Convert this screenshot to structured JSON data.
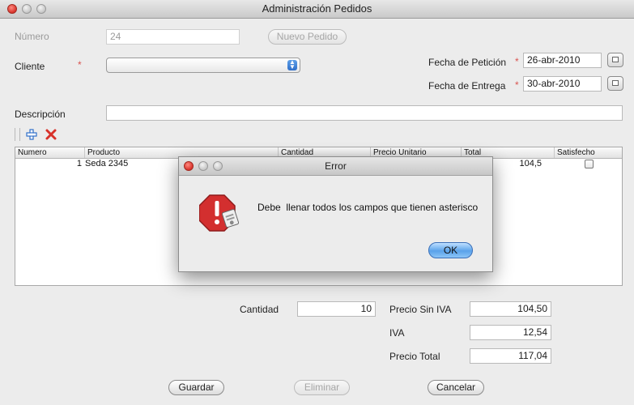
{
  "window": {
    "title": "Administración Pedidos"
  },
  "form": {
    "numero_label": "Número",
    "numero_value": "24",
    "nuevo_pedido_label": "Nuevo Pedido",
    "cliente_label": "Cliente",
    "required_mark": "*",
    "cliente_value": "",
    "fecha_peticion_label": "Fecha de Petición",
    "fecha_peticion_value": "26-abr-2010",
    "fecha_entrega_label": "Fecha de Entrega",
    "fecha_entrega_value": "30-abr-2010",
    "descripcion_label": "Descripción",
    "descripcion_value": ""
  },
  "toolbar": {
    "add_icon": "plus-icon",
    "delete_icon": "x-icon"
  },
  "table": {
    "columns": [
      "Numero",
      "Producto",
      "Cantidad",
      "Precio Unitario",
      "Total",
      "Satisfecho"
    ],
    "rows": [
      {
        "numero": "1",
        "producto": "Seda 2345",
        "total": "104,5",
        "satisfecho": false
      }
    ]
  },
  "totals": {
    "cantidad_label": "Cantidad",
    "cantidad_value": "10",
    "precio_sin_iva_label": "Precio Sin IVA",
    "precio_sin_iva_value": "104,50",
    "iva_label": "IVA",
    "iva_value": "12,54",
    "precio_total_label": "Precio Total",
    "precio_total_value": "117,04"
  },
  "actions": {
    "guardar_label": "Guardar",
    "eliminar_label": "Eliminar",
    "cancelar_label": "Cancelar"
  },
  "dialog": {
    "title": "Error",
    "message": "Debe  llenar todos los campos que tienen asterisco",
    "ok_label": "OK",
    "icon": "stop-warning-icon"
  },
  "colors": {
    "accent_blue": "#2f6fc9",
    "required_red": "#d9534f",
    "delete_red": "#d8322a"
  }
}
